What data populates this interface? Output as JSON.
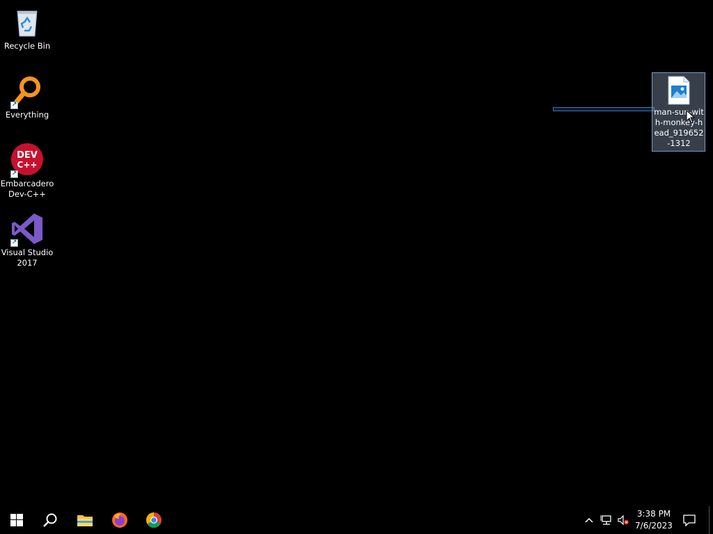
{
  "desktop": {
    "icons": [
      {
        "label": "Recycle Bin",
        "icon": "recycle-bin-icon"
      },
      {
        "label": "Everything",
        "icon": "everything-search-icon"
      },
      {
        "label": "Embarcadero Dev-C++",
        "icon": "devcpp-icon",
        "logo_text": "DEV C++"
      },
      {
        "label": "Visual Studio 2017",
        "icon": "visual-studio-icon"
      }
    ],
    "selected_file": {
      "label": "man-sun-with-monkey-head_919652-1312",
      "icon": "image-file-icon"
    }
  },
  "taskbar": {
    "pinned": [
      "start-button",
      "search-button",
      "file-explorer",
      "firefox",
      "chrome"
    ],
    "tray": {
      "time": "3:38 PM",
      "date": "7/6/2023"
    }
  },
  "colors": {
    "desktop": "#000000",
    "selection": "#7f9bbd",
    "accent": "#3a74b6"
  }
}
